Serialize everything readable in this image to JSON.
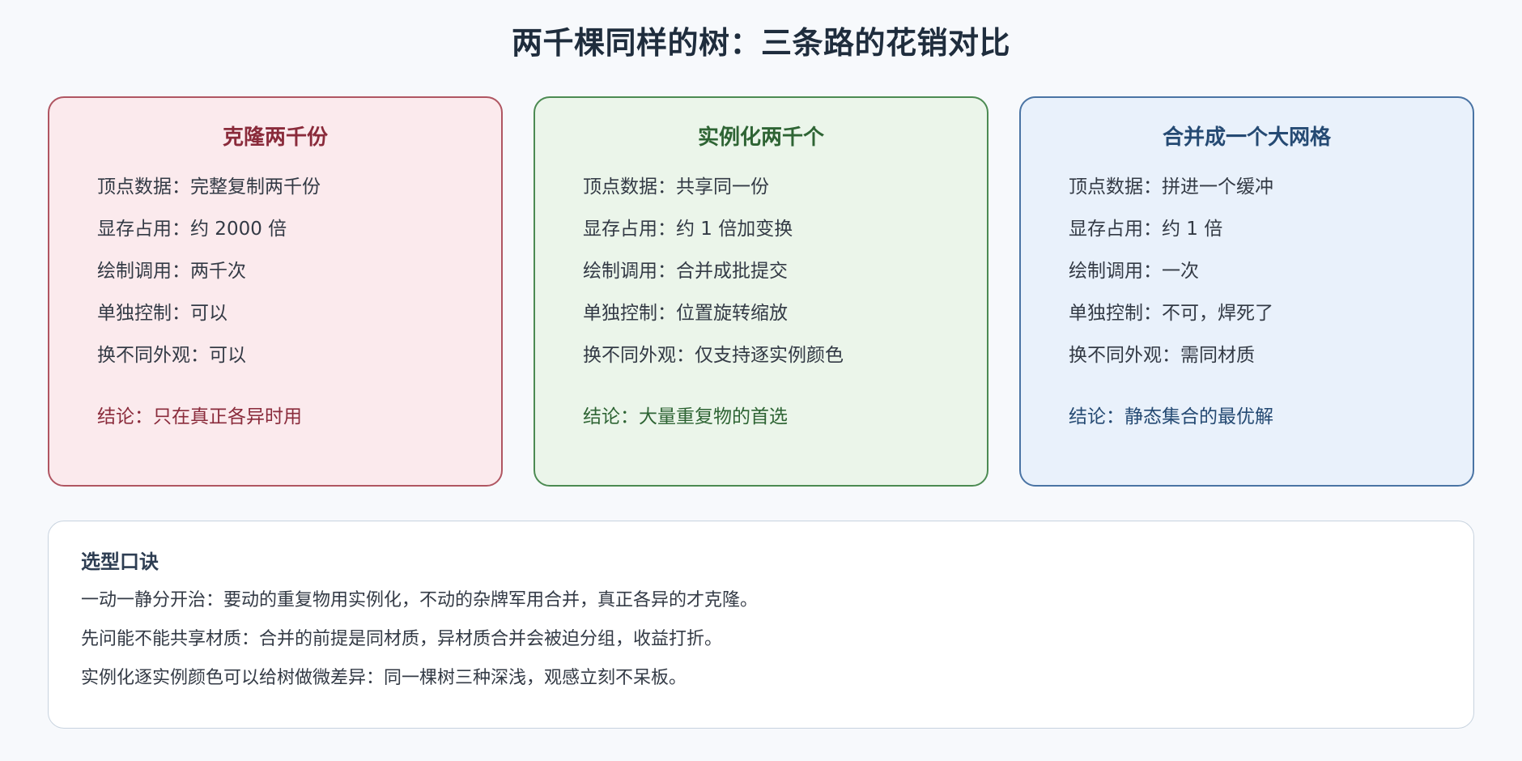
{
  "title": "两千棵同样的树：三条路的花销对比",
  "cards": [
    {
      "title": "克隆两千份",
      "lines": [
        "顶点数据：完整复制两千份",
        "显存占用：约 2000 倍",
        "绘制调用：两千次",
        "单独控制：可以",
        "换不同外观：可以"
      ],
      "conclusion": "结论：只在真正各异时用",
      "colors": {
        "border": "#b05662",
        "fill": "#fbeaed",
        "accent": "#8a2b3b"
      }
    },
    {
      "title": "实例化两千个",
      "lines": [
        "顶点数据：共享同一份",
        "显存占用：约 1 倍加变换",
        "绘制调用：合并成批提交",
        "单独控制：位置旋转缩放",
        "换不同外观：仅支持逐实例颜色"
      ],
      "conclusion": "结论：大量重复物的首选",
      "colors": {
        "border": "#4c8b52",
        "fill": "#ebf5ea",
        "accent": "#2e6434"
      }
    },
    {
      "title": "合并成一个大网格",
      "lines": [
        "顶点数据：拼进一个缓冲",
        "显存占用：约 1 倍",
        "绘制调用：一次",
        "单独控制：不可，焊死了",
        "换不同外观：需同材质"
      ],
      "conclusion": "结论：静态集合的最优解",
      "colors": {
        "border": "#4a74a4",
        "fill": "#e9f1fb",
        "accent": "#254a73"
      }
    }
  ],
  "tips": {
    "title": "选型口诀",
    "lines": [
      "一动一静分开治：要动的重复物用实例化，不动的杂牌军用合并，真正各异的才克隆。",
      "先问能不能共享材质：合并的前提是同材质，异材质合并会被迫分组，收益打折。",
      "实例化逐实例颜色可以给树做微差异：同一棵树三种深浅，观感立刻不呆板。"
    ]
  }
}
